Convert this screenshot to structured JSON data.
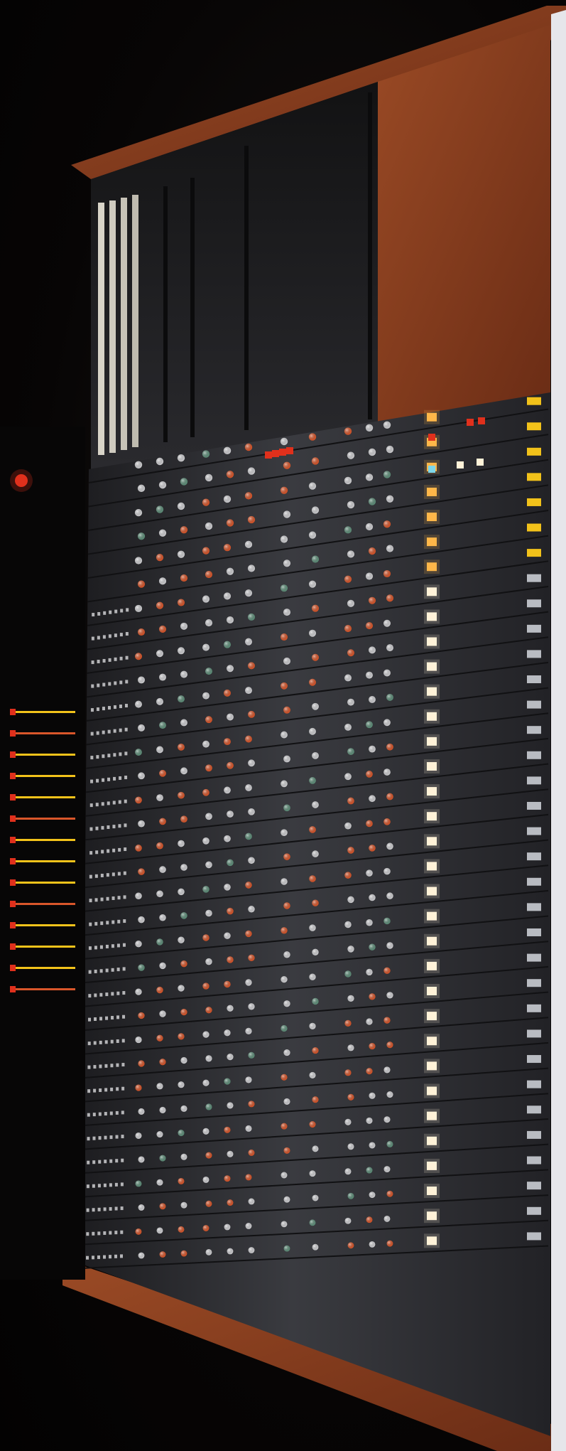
{
  "image": {
    "subject": "mixing-console",
    "palette": {
      "background": "#050404",
      "wood": "#6a2c15",
      "wood_highlight": "#9a4a25",
      "panel": "#2a2a2e",
      "panel_light": "#3b3c41",
      "meter_bridge": "#1c1c1f",
      "knob_red": "#d9562a",
      "knob_grey": "#cfcfd2",
      "knob_green": "#5f8f7a",
      "lamp_yellow": "#f2c21a",
      "lamp_amber": "#ffb84a",
      "lamp_red": "#e0301c",
      "lamp_white": "#fff2d8",
      "lamp_cyan": "#7fd6e8",
      "trim_white": "#e8e8ec"
    },
    "icons": [
      "console-knob",
      "indicator-lamp",
      "vu-meter",
      "patch-bay"
    ]
  }
}
